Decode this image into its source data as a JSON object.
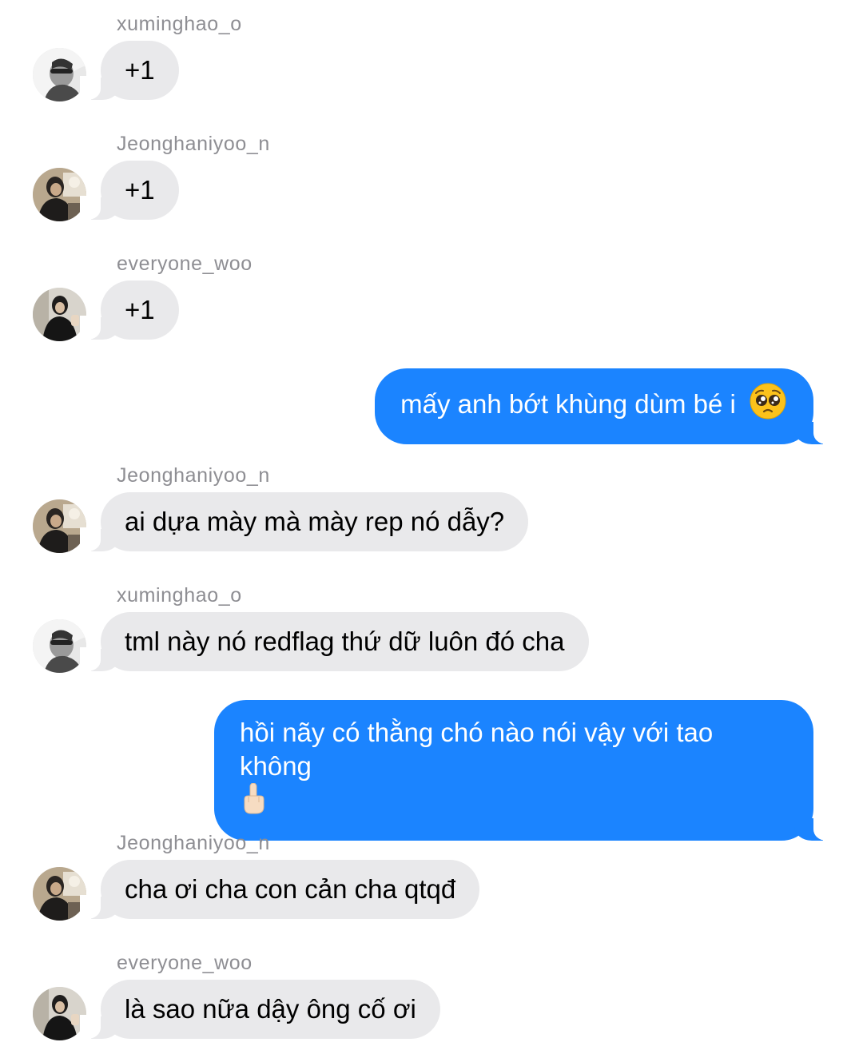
{
  "conversation": {
    "messages": [
      {
        "type": "incoming",
        "sender": "xuminghao_o",
        "avatar": "xuminghao-avatar",
        "text": "+1"
      },
      {
        "type": "incoming",
        "sender": "Jeonghaniyoo_n",
        "avatar": "jeonghaniyoo-avatar",
        "text": "+1"
      },
      {
        "type": "incoming",
        "sender": "everyone_woo",
        "avatar": "everyone-woo-avatar",
        "text": "+1"
      },
      {
        "type": "outgoing",
        "text": "mấy anh bớt khùng dùm bé i",
        "emoji": "pleading-face-icon"
      },
      {
        "type": "incoming",
        "sender": "Jeonghaniyoo_n",
        "avatar": "jeonghaniyoo-avatar",
        "text": "ai dựa mày mà mày rep nó dẫy?"
      },
      {
        "type": "incoming",
        "sender": "xuminghao_o",
        "avatar": "xuminghao-avatar",
        "text": "tml này nó redflag thứ dữ luôn đó cha"
      },
      {
        "type": "outgoing",
        "text": "hồi nãy có thằng chó nào nói vậy với tao không",
        "emoji": "middle-finger-icon"
      },
      {
        "type": "incoming",
        "sender": "Jeonghaniyoo_n",
        "avatar": "jeonghaniyoo-avatar",
        "text": "cha ơi cha con cản cha qtqđ"
      },
      {
        "type": "incoming",
        "sender": "everyone_woo",
        "avatar": "everyone-woo-avatar",
        "text": "là sao nữa dậy ông cố ơi"
      }
    ]
  },
  "colors": {
    "outgoing_bubble": "#1b84ff",
    "incoming_bubble": "#e9e9eb",
    "sender_name": "#8e8e93",
    "background": "#ffffff"
  }
}
